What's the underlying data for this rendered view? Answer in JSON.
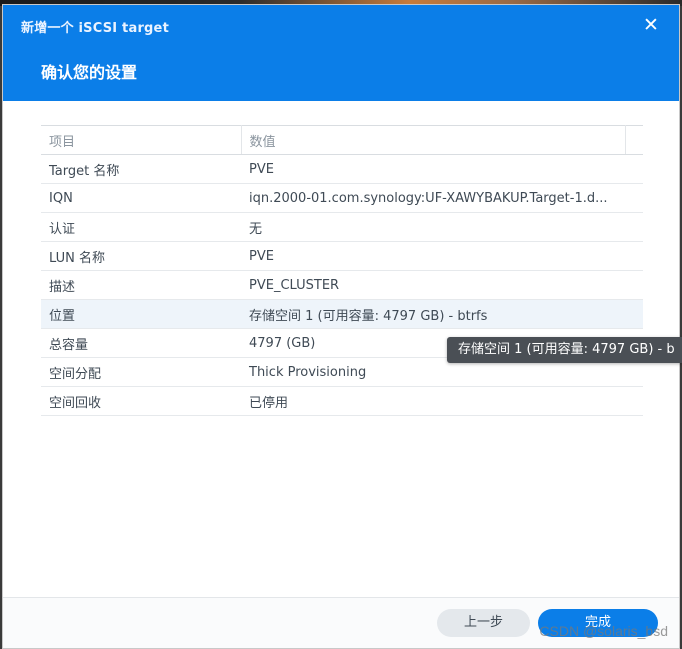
{
  "dialog": {
    "title": "新增一个 iSCSI target",
    "step_title": "确认您的设置",
    "close_glyph": "✕"
  },
  "table": {
    "headers": [
      "项目",
      "数值"
    ],
    "rows": [
      {
        "key": "Target 名称",
        "value": "PVE"
      },
      {
        "key": "IQN",
        "value": "iqn.2000-01.com.synology:UF-XAWYBAKUP.Target-1.d..."
      },
      {
        "key": "认证",
        "value": "无"
      },
      {
        "key": "LUN 名称",
        "value": "PVE"
      },
      {
        "key": "描述",
        "value": "PVE_CLUSTER"
      },
      {
        "key": "位置",
        "value": "存储空间 1 (可用容量: 4797 GB) - btrfs"
      },
      {
        "key": "总容量",
        "value": "4797 (GB)"
      },
      {
        "key": "空间分配",
        "value": "Thick Provisioning"
      },
      {
        "key": "空间回收",
        "value": "已停用"
      }
    ],
    "highlighted_row": 5
  },
  "tooltip": {
    "text": "存储空间 1 (可用容量: 4797 GB) - b"
  },
  "footer": {
    "back_label": "上一步",
    "done_label": "完成"
  },
  "watermark": "CSDN @solaris_bsd",
  "colors": {
    "header_blue": "#0b7ee8",
    "primary_button": "#0b7ee8",
    "secondary_button": "#e4e8ec",
    "tooltip_bg": "#4a4f55"
  }
}
